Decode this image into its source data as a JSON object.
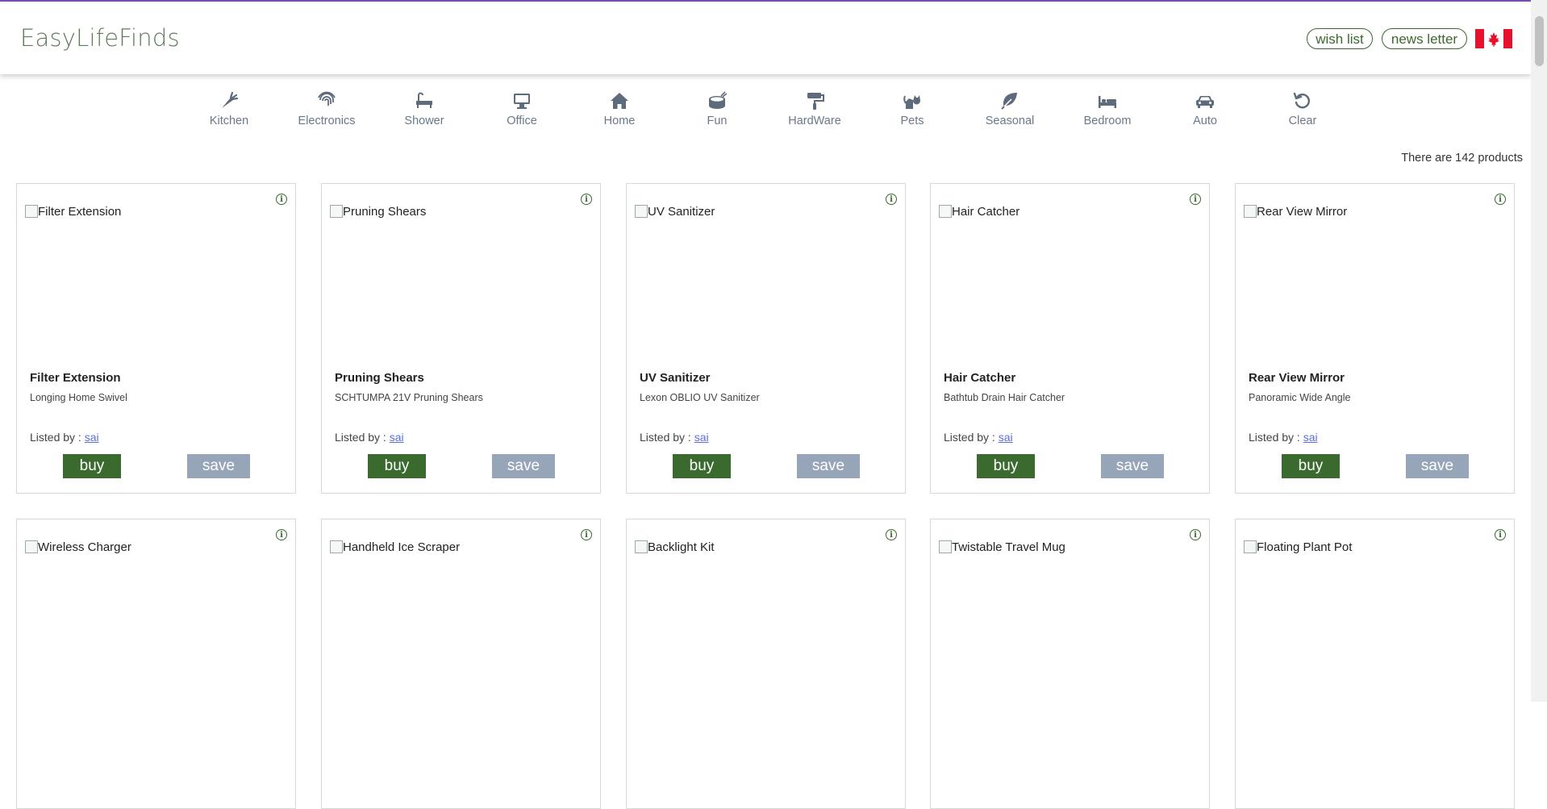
{
  "header": {
    "brand": "EasyLifeFinds",
    "wish_list": "wish list",
    "news_letter": "news letter",
    "flag_icon": "canada-flag-icon"
  },
  "colors": {
    "brand_text": "#5d7a5a",
    "accent_green": "#3a6a2e",
    "save_gray": "#97a5b9",
    "top_line": "#7a4fb8"
  },
  "categories": [
    {
      "label": "Kitchen",
      "icon": "carrot-icon"
    },
    {
      "label": "Electronics",
      "icon": "fingerprint-icon"
    },
    {
      "label": "Shower",
      "icon": "bath-icon"
    },
    {
      "label": "Office",
      "icon": "desktop-icon"
    },
    {
      "label": "Home",
      "icon": "home-icon"
    },
    {
      "label": "Fun",
      "icon": "drum-icon"
    },
    {
      "label": "HardWare",
      "icon": "paint-roller-icon"
    },
    {
      "label": "Pets",
      "icon": "cat-icon"
    },
    {
      "label": "Seasonal",
      "icon": "leaf-icon"
    },
    {
      "label": "Bedroom",
      "icon": "bed-icon"
    },
    {
      "label": "Auto",
      "icon": "car-icon"
    },
    {
      "label": "Clear",
      "icon": "undo-icon"
    }
  ],
  "product_count": "There are 142 products",
  "products": [
    {
      "alt": "Filter Extension",
      "title": "Filter Extension",
      "desc": "Longing Home Swivel",
      "listed_prefix": "Listed by : ",
      "listed_by": "sai",
      "buy": "buy",
      "save": "save"
    },
    {
      "alt": "Pruning Shears",
      "title": "Pruning Shears",
      "desc": "SCHTUMPA 21V Pruning Shears",
      "listed_prefix": "Listed by : ",
      "listed_by": "sai",
      "buy": "buy",
      "save": "save"
    },
    {
      "alt": "UV Sanitizer",
      "title": "UV Sanitizer",
      "desc": "Lexon OBLIO UV Sanitizer",
      "listed_prefix": "Listed by : ",
      "listed_by": "sai",
      "buy": "buy",
      "save": "save"
    },
    {
      "alt": "Hair Catcher",
      "title": "Hair Catcher",
      "desc": "Bathtub Drain Hair Catcher",
      "listed_prefix": "Listed by : ",
      "listed_by": "sai",
      "buy": "buy",
      "save": "save"
    },
    {
      "alt": "Rear View Mirror",
      "title": "Rear View Mirror",
      "desc": "Panoramic Wide Angle",
      "listed_prefix": "Listed by : ",
      "listed_by": "sai",
      "buy": "buy",
      "save": "save"
    },
    {
      "alt": "Wireless Charger"
    },
    {
      "alt": "Handheld Ice Scraper"
    },
    {
      "alt": "Backlight Kit"
    },
    {
      "alt": "Twistable Travel Mug"
    },
    {
      "alt": "Floating Plant Pot"
    }
  ]
}
